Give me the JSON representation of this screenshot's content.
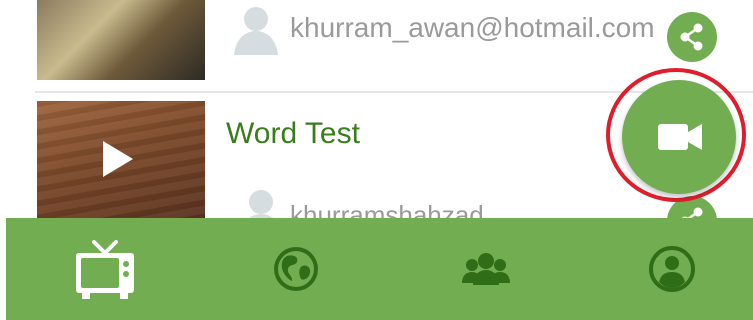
{
  "feed": {
    "items": [
      {
        "title": "",
        "author": "khurram_awan@hotmail.com",
        "thumbnail_icon": "video-thumbnail"
      },
      {
        "title": "Word Test",
        "author": "khurramshahzad",
        "thumbnail_icon": "video-thumbnail"
      }
    ]
  },
  "fab": {
    "icon": "video-camera-icon",
    "color": "#73ad52",
    "highlight_color": "#e01e2b"
  },
  "bottom_nav": {
    "items": [
      {
        "icon": "tv-icon",
        "selected": true
      },
      {
        "icon": "globe-icon",
        "selected": false
      },
      {
        "icon": "community-icon",
        "selected": false
      },
      {
        "icon": "profile-icon",
        "selected": false
      }
    ]
  },
  "colors": {
    "accent": "#73ad52",
    "title_green": "#3a7d1c",
    "secondary_text": "#9a9a9a"
  }
}
